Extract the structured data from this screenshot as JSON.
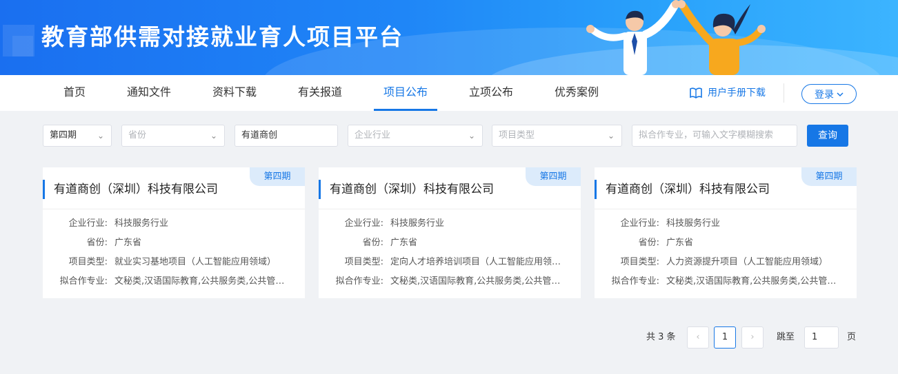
{
  "banner": {
    "title": "教育部供需对接就业育人项目平台"
  },
  "nav": {
    "items": [
      {
        "label": "首页"
      },
      {
        "label": "通知文件"
      },
      {
        "label": "资料下载"
      },
      {
        "label": "有关报道"
      },
      {
        "label": "项目公布"
      },
      {
        "label": "立项公布"
      },
      {
        "label": "优秀案例"
      }
    ],
    "active_index": 4,
    "manual_label": "用户手册下载",
    "login_label": "登录"
  },
  "filters": {
    "period": "第四期",
    "province_placeholder": "省份",
    "company": "有道商创",
    "industry_placeholder": "企业行业",
    "project_type_placeholder": "项目类型",
    "major_placeholder": "拟合作专业，可输入文字模糊搜索",
    "query_label": "查询"
  },
  "cards": [
    {
      "tag": "第四期",
      "title": "有道商创（深圳）科技有限公司",
      "fields": [
        {
          "label": "企业行业:",
          "value": "科技服务行业"
        },
        {
          "label": "省份:",
          "value": "广东省"
        },
        {
          "label": "项目类型:",
          "value": "就业实习基地项目（人工智能应用领域）"
        },
        {
          "label": "拟合作专业:",
          "value": "文秘类,汉语国际教育,公共服务类,公共管理类"
        }
      ]
    },
    {
      "tag": "第四期",
      "title": "有道商创（深圳）科技有限公司",
      "fields": [
        {
          "label": "企业行业:",
          "value": "科技服务行业"
        },
        {
          "label": "省份:",
          "value": "广东省"
        },
        {
          "label": "项目类型:",
          "value": "定向人才培养培训项目（人工智能应用领域）"
        },
        {
          "label": "拟合作专业:",
          "value": "文秘类,汉语国际教育,公共服务类,公共管理类"
        }
      ]
    },
    {
      "tag": "第四期",
      "title": "有道商创（深圳）科技有限公司",
      "fields": [
        {
          "label": "企业行业:",
          "value": "科技服务行业"
        },
        {
          "label": "省份:",
          "value": "广东省"
        },
        {
          "label": "项目类型:",
          "value": "人力资源提升项目（人工智能应用领域）"
        },
        {
          "label": "拟合作专业:",
          "value": "文秘类,汉语国际教育,公共服务类,公共管理类"
        }
      ]
    }
  ],
  "pagination": {
    "total_text": "共 3 条",
    "prev": "‹",
    "current": "1",
    "next": "›",
    "jump_label": "跳至",
    "jump_value": "1",
    "unit": "页"
  },
  "colors": {
    "primary": "#1677e6",
    "banner_start": "#1a6ff0",
    "banner_end": "#3cb4ff",
    "tag_bg": "#dcebfb"
  }
}
